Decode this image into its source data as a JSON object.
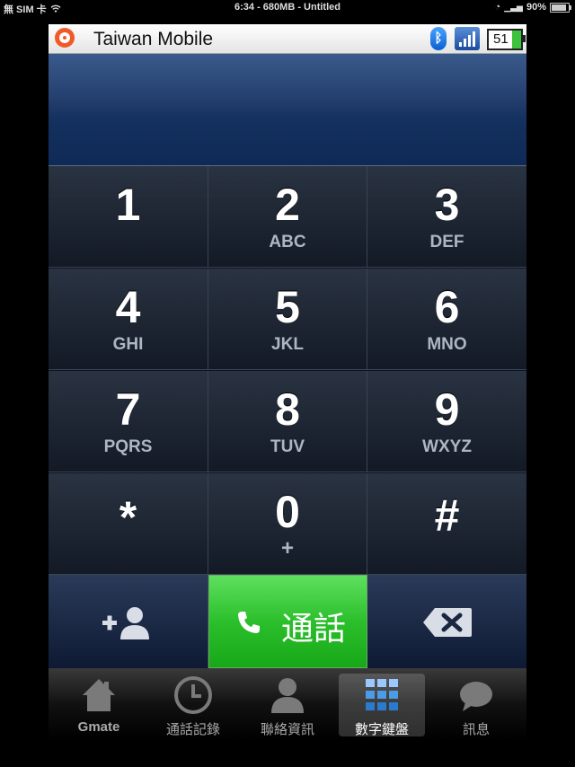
{
  "status_bar": {
    "carrier": "無 SIM 卡",
    "center": "6:34 - 680MB - Untitled",
    "battery": "90%",
    "battery_level": 0.9
  },
  "app": {
    "carrier_name": "Taiwan Mobile",
    "battery_level_text": "51",
    "battery_level": 0.51,
    "dialed_number": ""
  },
  "keypad": [
    {
      "digit": "1",
      "letters": ""
    },
    {
      "digit": "2",
      "letters": "ABC"
    },
    {
      "digit": "3",
      "letters": "DEF"
    },
    {
      "digit": "4",
      "letters": "GHI"
    },
    {
      "digit": "5",
      "letters": "JKL"
    },
    {
      "digit": "6",
      "letters": "MNO"
    },
    {
      "digit": "7",
      "letters": "PQRS"
    },
    {
      "digit": "8",
      "letters": "TUV"
    },
    {
      "digit": "9",
      "letters": "WXYZ"
    },
    {
      "digit": "*",
      "letters": ""
    },
    {
      "digit": "0",
      "letters": "+"
    },
    {
      "digit": "#",
      "letters": ""
    }
  ],
  "actions": {
    "call_label": "通話"
  },
  "tabs": [
    {
      "label": "Gmate",
      "icon": "home-icon",
      "active": false
    },
    {
      "label": "通話記錄",
      "icon": "clock-icon",
      "active": false
    },
    {
      "label": "聯絡資訊",
      "icon": "contact-icon",
      "active": false
    },
    {
      "label": "數字鍵盤",
      "icon": "keypad-icon",
      "active": true
    },
    {
      "label": "訊息",
      "icon": "message-icon",
      "active": false
    }
  ],
  "colors": {
    "call_green": "#2cbf2c",
    "display_blue": "#14305e",
    "key_dark": "#131a26"
  }
}
